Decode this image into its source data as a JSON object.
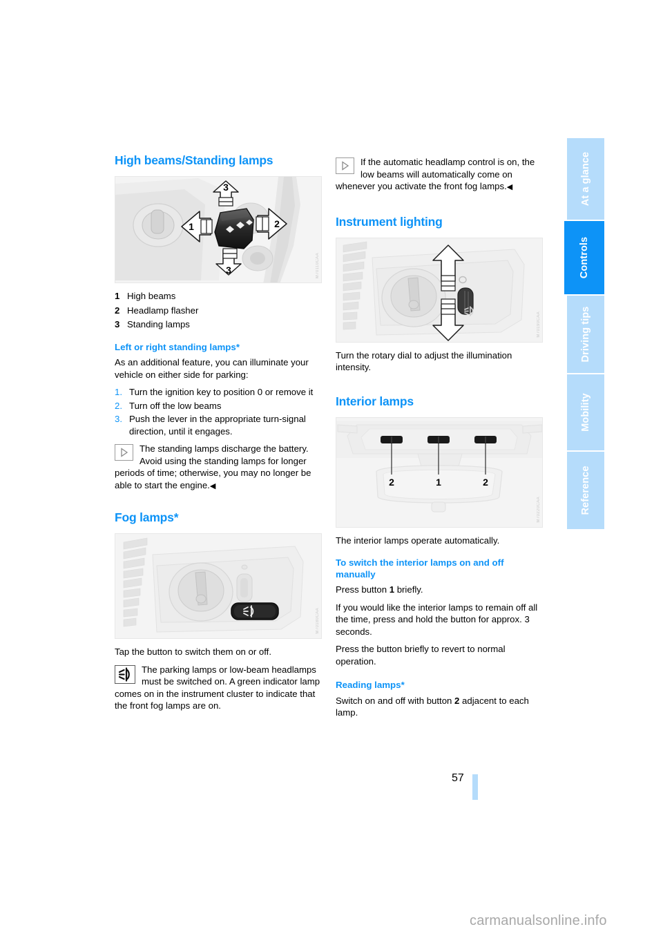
{
  "document": {
    "page_number": "57",
    "watermark": "carmanualsonline.info"
  },
  "sidebar": {
    "tabs": [
      {
        "label": "At a glance",
        "active": false
      },
      {
        "label": "Controls",
        "active": true
      },
      {
        "label": "Driving tips",
        "active": false
      },
      {
        "label": "Mobility",
        "active": false
      },
      {
        "label": "Reference",
        "active": false
      }
    ],
    "colors": {
      "inactive": "#b5dcfb",
      "active": "#0d93f7",
      "text": "#ffffff"
    }
  },
  "colors": {
    "heading_blue": "#0d93f7",
    "body_black": "#000000",
    "figure_bg": "#f2f2f2"
  },
  "left_column": {
    "heading": "High beams/Standing lamps",
    "figure_highbeam": {
      "alt": "Steering column stalk with directional arrows labelled 1, 2 and 3",
      "callouts": [
        "3",
        "1",
        "2",
        "3"
      ],
      "refcode": "M70110CAA"
    },
    "legend": [
      {
        "num": "1",
        "text": "High beams"
      },
      {
        "num": "2",
        "text": "Headlamp flasher"
      },
      {
        "num": "3",
        "text": "Standing lamps"
      }
    ],
    "subheading_standing": "Left or right standing lamps*",
    "standing_intro": "As an additional feature, you can illuminate your vehicle on either side for parking:",
    "standing_steps": [
      {
        "num": "1.",
        "text": "Turn the ignition key to position 0 or remove it"
      },
      {
        "num": "2.",
        "text": "Turn off the low beams"
      },
      {
        "num": "3.",
        "text": "Push the lever in the appropriate turn-signal direction, until it engages."
      }
    ],
    "standing_note": {
      "icon": "note-triangle-icon",
      "text": "The standing lamps discharge the battery. Avoid using the standing lamps for longer periods of time; otherwise, you may no longer be able to start the engine.",
      "endmark": "◀"
    },
    "heading_fog": "Fog lamps*",
    "figure_fog": {
      "alt": "Headlamp rotary switch panel with fog lamp button",
      "refcode": "M70180CAA"
    },
    "fog_text": "Tap the button to switch them on or off.",
    "fog_note": {
      "icon": "fog-lamp-icon",
      "text": "The parking lamps or low-beam headlamps must be switched on. A green indicator lamp comes on in the instrument cluster to indicate that the front fog lamps are on."
    }
  },
  "right_column": {
    "auto_note": {
      "icon": "note-triangle-icon",
      "text": "If the automatic headlamp control is on, the low beams will automatically come on whenever you activate the front fog lamps.",
      "endmark": "◀"
    },
    "heading_instrument": "Instrument lighting",
    "figure_instrument": {
      "alt": "Rotary dial on light switch panel with up and down arrows",
      "refcode": "M70190CAA"
    },
    "instrument_text": "Turn the rotary dial to adjust the illumination intensity.",
    "heading_interior": "Interior lamps",
    "figure_interior": {
      "alt": "Overhead console with interior lamp buttons labelled 2, 1 and 2",
      "callouts": [
        "2",
        "1",
        "2"
      ],
      "refcode": "M70220CAA"
    },
    "interior_text": "The interior lamps operate automatically.",
    "subheading_manual": "To switch the interior lamps on and off manually",
    "manual_paragraphs": [
      {
        "pre": "Press button ",
        "bold": "1",
        "post": " briefly."
      },
      {
        "pre": "If you would like the interior lamps to remain off all the time, press and hold the button for approx. 3 seconds.",
        "bold": "",
        "post": ""
      },
      {
        "pre": "Press the button briefly to revert to normal operation.",
        "bold": "",
        "post": ""
      }
    ],
    "subheading_reading": "Reading lamps*",
    "reading_paragraph": {
      "pre": "Switch on and off with button ",
      "bold": "2",
      "post": " adjacent to each lamp."
    }
  }
}
